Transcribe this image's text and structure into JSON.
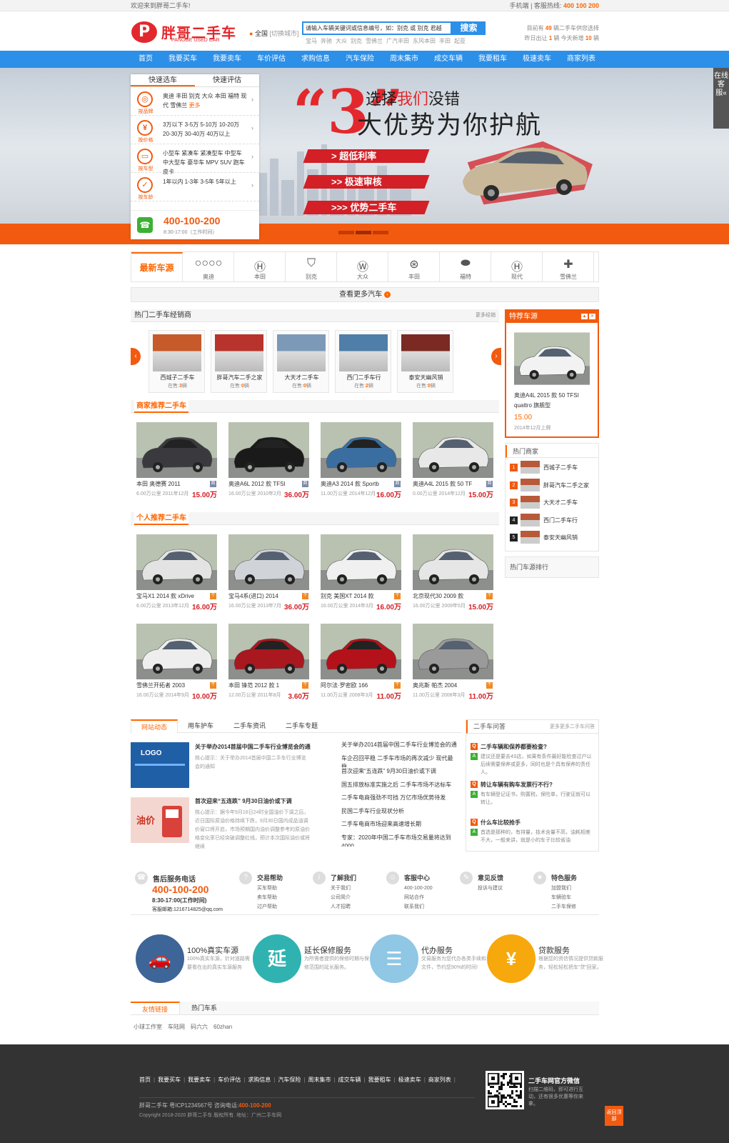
{
  "topbar": {
    "welcome": "欢迎来到胖哥二手车!",
    "mobile": "手机端",
    "hotline_label": "客服热线:",
    "hotline": "400 100 200"
  },
  "header": {
    "logo_text": "胖哥二手车",
    "logo_sub": "PANGGE USED CAR",
    "city": "全国",
    "city_switch": "[切换城市]",
    "search_placeholder": "请输入车辆关键词或信息编号，如：别克 或 别克 君越",
    "search_button": "搜索",
    "hot_keywords": [
      "宝马",
      "奔驰",
      "大众",
      "别克",
      "雪佛兰",
      "广汽丰田",
      "东风本田",
      "丰田",
      "起亚"
    ],
    "stat_line1_pre": "目前有",
    "stat_line1_num": "49",
    "stat_line1_post": "辆二手车供您选择",
    "stat_line2_pre": "昨日出让",
    "stat_line2_num": "1",
    "stat_line2_mid": "辆 今天新增",
    "stat_line2_num2": "10",
    "stat_line2_post": "辆"
  },
  "nav": [
    "首页",
    "我要买车",
    "我要卖车",
    "车价评估",
    "求购信息",
    "汽车保险",
    "周末集市",
    "成交车辆",
    "我要租车",
    "极速卖车",
    "商家列表"
  ],
  "banner": {
    "big_num": "3",
    "line1_a": "选择",
    "line1_red": "我们",
    "line1_b": "没错",
    "line2": "大优势为你护航",
    "ribbons": [
      "> 超低利率",
      ">> 极速审核",
      ">>> 优势二手车"
    ],
    "service_float": "在线客服«"
  },
  "quick": {
    "tabs": [
      "快速选车",
      "快速评估"
    ],
    "rows": [
      {
        "icon": "steering-wheel-icon",
        "glyph": "◎",
        "label": "按品牌",
        "text": "奥迪 丰田 别克 大众 本田 福特 现代 雪佛兰",
        "more": "更多"
      },
      {
        "icon": "yen-icon",
        "glyph": "¥",
        "label": "按价格",
        "text": "3万以下 3-5万 5-10万 10-20万 20-30万 30-40万 40万以上",
        "more": ""
      },
      {
        "icon": "car-icon",
        "glyph": "▭",
        "label": "按车型",
        "text": "小型车 紧凑车 紧凑型车 中型车 中大型车 豪华车 MPV SUV 跑车 皮卡",
        "more": ""
      },
      {
        "icon": "check-icon",
        "glyph": "✓",
        "label": "按车龄",
        "text": "1年以内 1-3年 3-5年 5年以上",
        "more": ""
      }
    ],
    "phone": "400-100-200",
    "phone_time": "8:30-17:00（工作时间）"
  },
  "brands": {
    "title": "最新车源",
    "items": [
      {
        "name": "奥迪",
        "glyph": "○○○○"
      },
      {
        "name": "本田",
        "glyph": "Ⓗ"
      },
      {
        "name": "别克",
        "glyph": "⛉"
      },
      {
        "name": "大众",
        "glyph": "Ⓦ"
      },
      {
        "name": "丰田",
        "glyph": "⊛"
      },
      {
        "name": "福特",
        "glyph": "⬬"
      },
      {
        "name": "现代",
        "glyph": "Ⓗ"
      },
      {
        "name": "雪佛兰",
        "glyph": "✚"
      }
    ],
    "more": "查看更多汽车"
  },
  "dealers": {
    "title": "热门二手车经销商",
    "more": "更多经销",
    "items": [
      {
        "name": "西城子二手车",
        "count_label": "在售:",
        "count": "3",
        "unit": "辆",
        "color": "#c65a2a"
      },
      {
        "name": "胖哥汽车二手之家",
        "count_label": "在售:",
        "count": "0",
        "unit": "辆",
        "color": "#b8332c"
      },
      {
        "name": "大天才二手车",
        "count_label": "在售:",
        "count": "0",
        "unit": "辆",
        "color": "#7c9ab8"
      },
      {
        "name": "西门二手车行",
        "count_label": "在售:",
        "count": "2",
        "unit": "辆",
        "color": "#4f7ea8"
      },
      {
        "name": "泰安天幽风销",
        "count_label": "在售:",
        "count": "0",
        "unit": "辆",
        "color": "#7a2a22"
      }
    ]
  },
  "shop_rec": {
    "title": "商家推荐二手车",
    "cars": [
      {
        "name": "本田 奥德赛 2011",
        "spec": "6.00万公里 2011年12月",
        "price": "15.00万",
        "color": "#3a3a3e",
        "tag": "商"
      },
      {
        "name": "奥迪A6L 2012 款 TFSI",
        "spec": "16.00万公里 2010年2月",
        "price": "36.00万",
        "color": "#1a1a1a",
        "tag": "商"
      },
      {
        "name": "奥迪A3 2014 款 Sportb",
        "spec": "11.00万公里 2014年12月",
        "price": "16.00万",
        "color": "#3b6ea0",
        "tag": "商"
      },
      {
        "name": "奥迪A4L 2015 款 50 TF",
        "spec": "0.00万公里 2014年12月",
        "price": "15.00万",
        "color": "#e8e8e8",
        "tag": "商"
      }
    ]
  },
  "personal_rec": {
    "title": "个人推荐二手车",
    "cars": [
      {
        "name": "宝马X1 2014 款 xDrive",
        "spec": "6.00万公里 2013年12月",
        "price": "16.00万",
        "color": "#e3e3e3",
        "tag": "个"
      },
      {
        "name": "宝马4系(进口) 2014",
        "spec": "16.00万公里 2013年7月",
        "price": "36.00万",
        "color": "#d0d4d8",
        "tag": "个"
      },
      {
        "name": "别克 美国XT 2014 款",
        "spec": "16.00万公里 2014年3月",
        "price": "16.00万",
        "color": "#f0f0f0",
        "tag": "个"
      },
      {
        "name": "北京现代30 2009 款",
        "spec": "16.00万公里 2009年5月",
        "price": "15.00万",
        "color": "#e6e6e6",
        "tag": "个"
      },
      {
        "name": "雪佛兰开拓者 2003",
        "spec": "16.00万公里 2014年9月",
        "price": "10.00万",
        "color": "#eeeeee",
        "tag": "个"
      },
      {
        "name": "本田 锋范 2012 款 1",
        "spec": "12.00万公里 2011年8月",
        "price": "3.60万",
        "color": "#a8181e",
        "tag": "个"
      },
      {
        "name": "阿尔法·罗密欧 166",
        "spec": "11.00万公里 2008年3月",
        "price": "11.00万",
        "color": "#b3121a",
        "tag": "个"
      },
      {
        "name": "奥兆斯 帕杰 2004",
        "spec": "11.00万公里 2008年3月",
        "price": "11.00万",
        "color": "#9a9a9a",
        "tag": "个"
      }
    ]
  },
  "featured": {
    "title": "特荐车源",
    "name": "奥迪A4L 2015 款 50 TFSI quattro 旗舰型",
    "price": "15.00",
    "date": "2014年12月上牌",
    "color": "#f2f2f2"
  },
  "hot_shops": {
    "title": "热门商家",
    "items": [
      {
        "rank": "1",
        "name": "西城子二手车",
        "color": "#f25a0f"
      },
      {
        "rank": "2",
        "name": "胖哥汽车二手之家",
        "color": "#f25a0f"
      },
      {
        "rank": "3",
        "name": "大天才二手车",
        "color": "#f25a0f"
      },
      {
        "rank": "4",
        "name": "西门二手车行",
        "color": "#222"
      },
      {
        "rank": "5",
        "name": "泰安天幽风销",
        "color": "#222"
      }
    ]
  },
  "hot_rank_title": "热门车源排行",
  "news": {
    "tabs": [
      "网站动态",
      "用车护车",
      "二手车资讯",
      "二手车专题"
    ],
    "featured": [
      {
        "title": "关于举办2014首届中国二手车行业博览会的通",
        "desc": "核心提示：关于举办2014首届中国二手车行业博览会的通知",
        "img_text": "LOGO"
      },
      {
        "title": "首次迎来“五连跌” 9月30日油价或下调",
        "desc": "核心提示：据今年9月16日24时全国油价下调之后，近日国际原油价格持续下跌，9月30日国内成品油调价窗口将开启，市场预期国内油价调整参考的原油价格变化率已经突破调整红线，预计本次国际油价或将继续",
        "img_text": "油价"
      }
    ],
    "list": [
      "关于举办2014首届中国二手车行业博览会的通",
      "车企召回平稳 二手车市场的再次减少 现代最稳",
      "首次迎来“五连跌” 9月30日油价或下调",
      "国五排放标准实施之后 二手车市场不达标车",
      "二手车电商强劲不可挡 万亿市场优势待发",
      "民国二手车行业现状分析",
      "二手车电商市场迎来高速增长期",
      "专家：2020年中国二手车市场交易量将达到4000"
    ]
  },
  "qa": {
    "title": "二手车问答",
    "more": "更多更多二手车问答",
    "items": [
      {
        "q": "二手车辆和保养都要检查?",
        "a": "建议还是要去4S店，如果有条件最好能检查过户以后续需要保养或更多，同时也是个具有保养的责任人。"
      },
      {
        "q": "转让车辆有购车发票行不行?",
        "a": "有车辆登记证书，购置税，保险单，行驶证就可以转让。"
      },
      {
        "q": "什么车比较抢手",
        "a": "首选是那种的，有排量，技术含量不高，油耗相差不大，一般来讲，就是小的车子比较省油"
      }
    ]
  },
  "service": {
    "phone_title": "售后服务电话",
    "phone": "400-100-200",
    "time": "8:30-17:00(工作时间)",
    "mail": "客服邮箱:1216714825@qq.com",
    "cols": [
      {
        "icon": "help-icon",
        "glyph": "?",
        "title": "交易帮助",
        "links": [
          "买车帮助",
          "卖车帮助",
          "过户帮助"
        ]
      },
      {
        "icon": "info-icon",
        "glyph": "i",
        "title": "了解我们",
        "links": [
          "关于我们",
          "公司简介",
          "人才招聘"
        ]
      },
      {
        "icon": "user-icon",
        "glyph": "☺",
        "title": "客服中心",
        "links": [
          "400-100-200",
          "网站合作",
          "联系我们"
        ]
      },
      {
        "icon": "chat-icon",
        "glyph": "✎",
        "title": "意见反馈",
        "links": [
          "投诉与建议"
        ]
      },
      {
        "icon": "star-icon",
        "glyph": "★",
        "title": "特色服务",
        "links": [
          "加盟我们",
          "车辆验车",
          "二手车保修"
        ]
      }
    ]
  },
  "features": [
    {
      "title": "100%真实车源",
      "desc": "100%真实车源，针对道路需要看在出的真实车源服务",
      "color": "#3e6597",
      "glyph": "🚗"
    },
    {
      "title": "延长保修服务",
      "desc": "为所需者提供的保修时期与保修范围的延长服务。",
      "color": "#30b3b0",
      "glyph": "延"
    },
    {
      "title": "代办服务",
      "desc": "交易服务为您代办各类手续和文件，节约您90%的时间!",
      "color": "#8fc7e4",
      "glyph": "☰"
    },
    {
      "title": "贷款服务",
      "desc": "根据您的资信情况提供贷款服务，轻松轻松把车“贷”回家。",
      "color": "#f7a80c",
      "glyph": "¥"
    }
  ],
  "links": {
    "tabs": [
      "友情链接",
      "热门车系"
    ],
    "items": [
      "小球工作室",
      "车陆网",
      "码六六",
      "60zhan"
    ]
  },
  "footer": {
    "nav": [
      "首页",
      "我要买车",
      "我要卖车",
      "车价评估",
      "求购信息",
      "汽车保险",
      "周末集市",
      "成交车辆",
      "我要租车",
      "极速卖车",
      "商家列表"
    ],
    "icp_pre": "胖哥二手车   粤ICP1234567号   咨询电话:",
    "icp_tel": "400-100-200",
    "copyright": "Copyright 2018-2020 胖哥二手车 版权所有.   地址：广州二手车网",
    "qr_title": "二手车网官方微信",
    "qr_desc": "扫描二维码，即可进行互动，还有很多优惠等你来拿。",
    "totop": "返回顶部"
  }
}
